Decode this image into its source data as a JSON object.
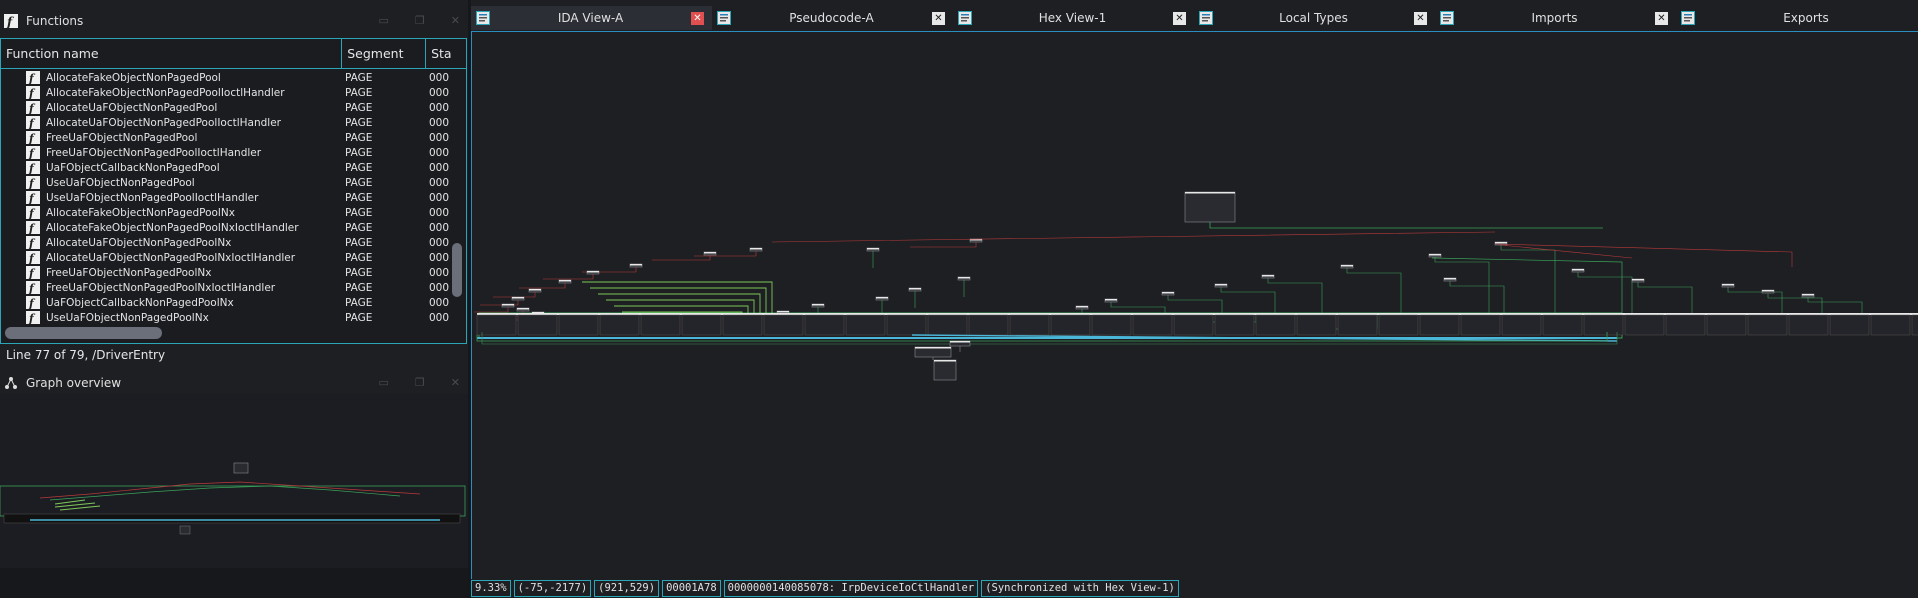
{
  "functions_panel": {
    "title": "Functions",
    "columns": [
      "Function name",
      "Segment",
      "Sta"
    ],
    "rows": [
      {
        "name": "AllocateFakeObjectNonPagedPool",
        "segment": "PAGE",
        "start": "000"
      },
      {
        "name": "AllocateFakeObjectNonPagedPoolIoctlHandler",
        "segment": "PAGE",
        "start": "000"
      },
      {
        "name": "AllocateUaFObjectNonPagedPool",
        "segment": "PAGE",
        "start": "000"
      },
      {
        "name": "AllocateUaFObjectNonPagedPoolIoctlHandler",
        "segment": "PAGE",
        "start": "000"
      },
      {
        "name": "FreeUaFObjectNonPagedPool",
        "segment": "PAGE",
        "start": "000"
      },
      {
        "name": "FreeUaFObjectNonPagedPoolIoctlHandler",
        "segment": "PAGE",
        "start": "000"
      },
      {
        "name": "UaFObjectCallbackNonPagedPool",
        "segment": "PAGE",
        "start": "000"
      },
      {
        "name": "UseUaFObjectNonPagedPool",
        "segment": "PAGE",
        "start": "000"
      },
      {
        "name": "UseUaFObjectNonPagedPoolIoctlHandler",
        "segment": "PAGE",
        "start": "000"
      },
      {
        "name": "AllocateFakeObjectNonPagedPoolNx",
        "segment": "PAGE",
        "start": "000"
      },
      {
        "name": "AllocateFakeObjectNonPagedPoolNxIoctlHandler",
        "segment": "PAGE",
        "start": "000"
      },
      {
        "name": "AllocateUaFObjectNonPagedPoolNx",
        "segment": "PAGE",
        "start": "000"
      },
      {
        "name": "AllocateUaFObjectNonPagedPoolNxIoctlHandler",
        "segment": "PAGE",
        "start": "000"
      },
      {
        "name": "FreeUaFObjectNonPagedPoolNx",
        "segment": "PAGE",
        "start": "000"
      },
      {
        "name": "FreeUaFObjectNonPagedPoolNxIoctlHandler",
        "segment": "PAGE",
        "start": "000"
      },
      {
        "name": "UaFObjectCallbackNonPagedPoolNx",
        "segment": "PAGE",
        "start": "000"
      },
      {
        "name": "UseUaFObjectNonPagedPoolNx",
        "segment": "PAGE",
        "start": "000"
      }
    ],
    "line_info": "Line 77 of 79, /DriverEntry"
  },
  "graph_overview": {
    "title": "Graph overview"
  },
  "tabs": [
    {
      "label": "IDA View-A",
      "icon": "disasm-view-icon",
      "active": true
    },
    {
      "label": "Pseudocode-A",
      "icon": "pseudocode-icon",
      "active": false
    },
    {
      "label": "Hex View-1",
      "icon": "hex-view-icon",
      "active": false
    },
    {
      "label": "Local Types",
      "icon": "local-types-icon",
      "active": false
    },
    {
      "label": "Imports",
      "icon": "imports-icon",
      "active": false
    },
    {
      "label": "Exports",
      "icon": "exports-icon",
      "active": false
    }
  ],
  "status_bar": {
    "zoom": "9.33%",
    "coords": "(-75,-2177)",
    "size": "(921,529)",
    "offset": "00001A78",
    "address": "0000000140085078: IrpDeviceIoCtlHandler",
    "sync": "(Synchronized with Hex View-1)"
  },
  "colors": {
    "accent": "#2aa6b8",
    "edge_green": "#3aa35a",
    "edge_red": "#b83a3a",
    "edge_blue": "#4ab6d8",
    "active_close": "#e05050"
  }
}
